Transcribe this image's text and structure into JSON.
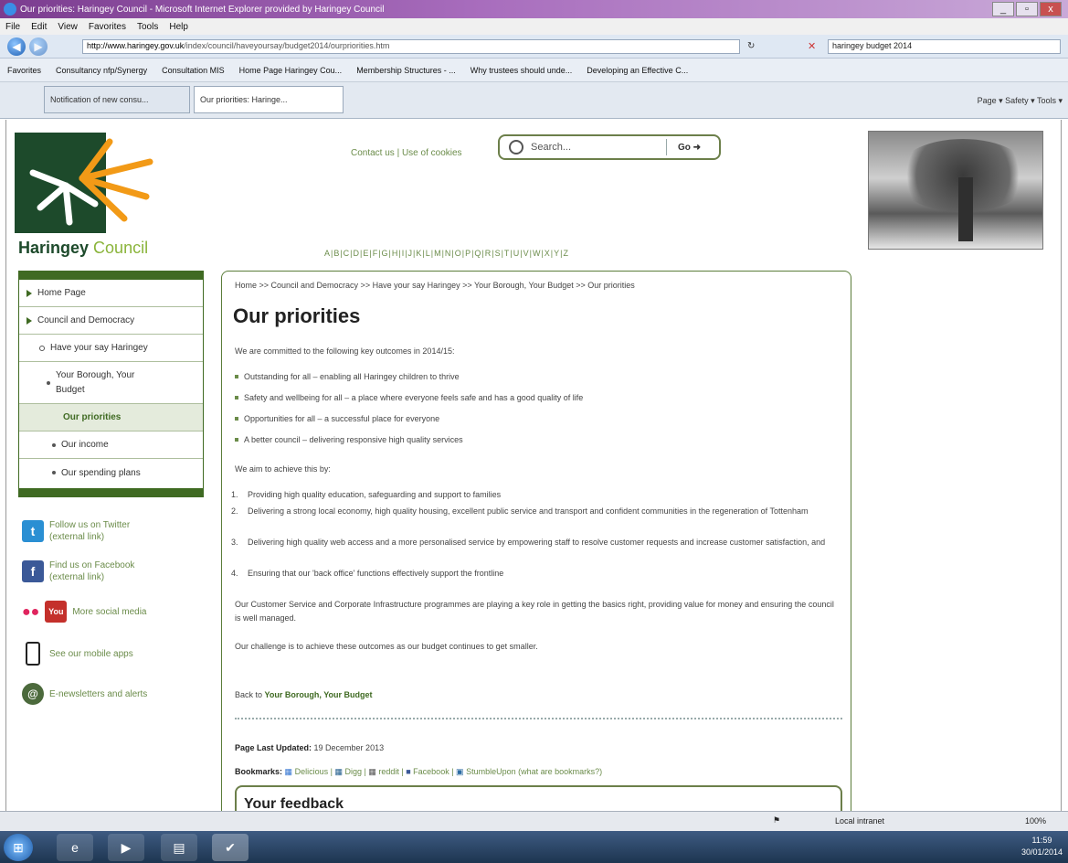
{
  "browser": {
    "window_title": "Our priorities: Haringey Council - Microsoft Internet Explorer provided by Haringey Council",
    "menu": [
      "File",
      "Edit",
      "View",
      "Favorites",
      "Tools",
      "Help"
    ],
    "url_host": "http://www.haringey.gov.uk",
    "url_path": "/index/council/haveyoursay/budget2014/ourpriorities.htm",
    "search_value": "haringey budget 2014",
    "favorites_label": "Favorites",
    "favorites": [
      "Consultancy nfp/Synergy",
      "Consultation MIS",
      "Home Page Haringey Cou...",
      "Membership Structures - ...",
      "Why trustees should unde...",
      "Developing an Effective C..."
    ],
    "tabs": [
      "Notification of new consu...",
      "Our priorities: Haringe..."
    ],
    "commands": "Page ▾  Safety ▾  Tools ▾",
    "status_zone": "Local intranet",
    "zoom": "100%",
    "clock_time": "11:59",
    "clock_date": "30/01/2014"
  },
  "site": {
    "brand_main": "Haringey",
    "brand_sub": "Council",
    "top_links": "Contact us | Use of cookies",
    "search_placeholder": "Search...",
    "search_button": "Go",
    "az_index": "A|B|C|D|E|F|G|H|I|J|K|L|M|N|O|P|Q|R|S|T|U|V|W|X|Y|Z"
  },
  "leftnav": {
    "items": [
      {
        "label": "Home Page"
      },
      {
        "label": "Council and Democracy"
      },
      {
        "label": "Have your say Haringey"
      },
      {
        "label": "Your Borough, Your Budget"
      },
      {
        "label": "Our priorities"
      },
      {
        "label": "Our income"
      },
      {
        "label": "Our spending plans"
      }
    ]
  },
  "social": {
    "twitter": "Follow us on Twitter (external link)",
    "facebook": "Find us on Facebook (external link)",
    "more": "More social media",
    "mobile": "See our mobile apps",
    "newsletter": "E-newsletters and alerts"
  },
  "main": {
    "breadcrumb": "Home >> Council and Democracy >> Have your say Haringey >> Your Borough, Your Budget >> Our priorities",
    "title": "Our priorities",
    "intro": "We are committed to the following key outcomes in 2014/15:",
    "outcomes": [
      "Outstanding for all – enabling all Haringey children to thrive",
      "Safety and wellbeing for all – a place where everyone feels safe and has a good quality of life",
      "Opportunities for all – a successful place for everyone",
      "A better council – delivering responsive high quality services"
    ],
    "aim_intro": "We aim to achieve this by:",
    "aims": [
      "Providing high quality education, safeguarding and support to families",
      "Delivering a strong local economy, high quality housing, excellent public service and transport and confident communities in the regeneration of Tottenham",
      "Delivering high quality web access and a more personalised service by empowering staff to resolve customer requests and increase customer satisfaction, and",
      "Ensuring that our 'back office' functions effectively support the frontline"
    ],
    "para1": "Our Customer Service and Corporate Infrastructure programmes are playing a key role in getting the basics right, providing value for money and ensuring the council is well managed.",
    "para2": "Our challenge is to achieve these outcomes as our budget continues to get smaller.",
    "back_prefix": "Back to",
    "back_link": "Your Borough, Your Budget",
    "updated_label": "Page Last Updated:",
    "updated_value": "19 December 2013",
    "bookmarks_label": "Bookmarks:",
    "bookmarks": [
      "Delicious",
      "Digg",
      "reddit",
      "Facebook",
      "StumbleUpon"
    ],
    "bookmarks_help": "(what are bookmarks?)",
    "feedback_title": "Your feedback"
  }
}
